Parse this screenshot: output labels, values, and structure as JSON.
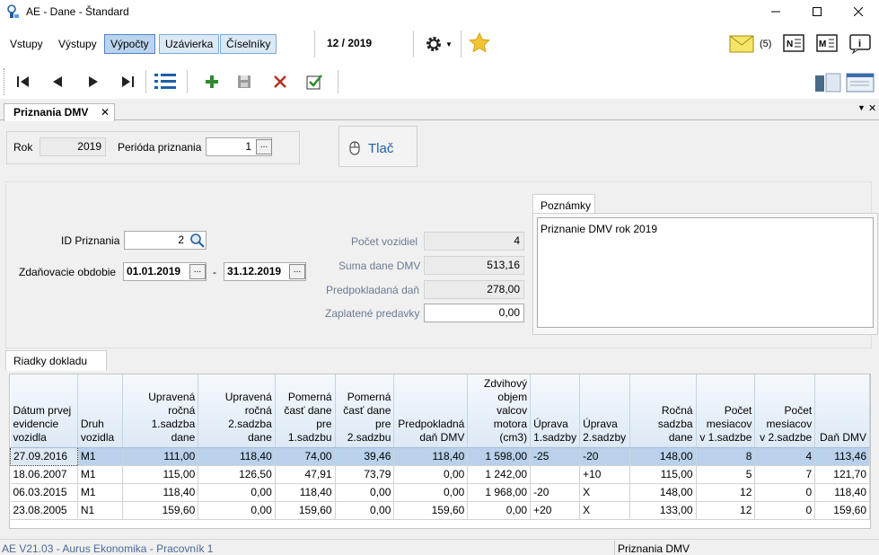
{
  "window": {
    "title": "AE - Dane - Štandard"
  },
  "menu": {
    "items": [
      "Vstupy",
      "Výstupy"
    ],
    "buttons": [
      "Výpočty",
      "Uzávierka",
      "Číselníky"
    ],
    "period": "12 / 2019",
    "message_count": "(5)"
  },
  "tab": {
    "label": "Priznania DMV"
  },
  "header": {
    "rok_label": "Rok",
    "rok_value": "2019",
    "perioda_label": "Perióda priznania",
    "perioda_value": "1",
    "print_label": "Tlač"
  },
  "form": {
    "id_label": "ID Priznania",
    "id_value": "2",
    "obdobie_label": "Zdaňovacie obdobie",
    "date_from": "01.01.2019",
    "date_sep": "-",
    "date_to": "31.12.2019",
    "pocet_label": "Počet vozidiel",
    "pocet_value": "4",
    "suma_label": "Suma dane DMV",
    "suma_value": "513,16",
    "predp_label": "Predpokladaná daň",
    "predp_value": "278,00",
    "zapl_label": "Zaplatené predavky",
    "zapl_value": "0,00"
  },
  "notes": {
    "tab_label": "Poznámky",
    "text": "Priznanie DMV rok 2019"
  },
  "grid": {
    "tab_label": "Riadky dokladu",
    "columns": [
      "Dátum prvej evidencie vozidla",
      "Druh vozidla",
      "Upravená ročná 1.sadzba dane",
      "Upravená ročná 2.sadzba dane",
      "Pomerná časť dane pre 1.sadzbu",
      "Pomerná časť dane pre 2.sadzbu",
      "Predpokladná daň DMV",
      "Zdvihový objem valcov motora (cm3)",
      "Úprava 1.sadzby",
      "Úprava 2.sadzby",
      "Ročná sadzba dane",
      "Počet mesiacov v 1.sadzbe",
      "Počet mesiacov v 2.sadzbe",
      "Daň DMV"
    ],
    "rows": [
      [
        "27.09.2016",
        "M1",
        "111,00",
        "118,40",
        "74,00",
        "39,46",
        "118,40",
        "1 598,00",
        "-25",
        "-20",
        "148,00",
        "8",
        "4",
        "113,46"
      ],
      [
        "18.06.2007",
        "M1",
        "115,00",
        "126,50",
        "47,91",
        "73,79",
        "0,00",
        "1 242,00",
        "",
        "+10",
        "115,00",
        "5",
        "7",
        "121,70"
      ],
      [
        "06.03.2015",
        "M1",
        "118,40",
        "0,00",
        "118,40",
        "0,00",
        "0,00",
        "1 968,00",
        "-20",
        "X",
        "148,00",
        "12",
        "0",
        "118,40"
      ],
      [
        "23.08.2005",
        "N1",
        "159,60",
        "0,00",
        "159,60",
        "0,00",
        "159,60",
        "0,00",
        "+20",
        "X",
        "133,00",
        "12",
        "0",
        "159,60"
      ]
    ]
  },
  "status": {
    "left": "AE V21.03 - Aurus Ekonomika - Pracovník 1",
    "right": "Priznania DMV"
  }
}
